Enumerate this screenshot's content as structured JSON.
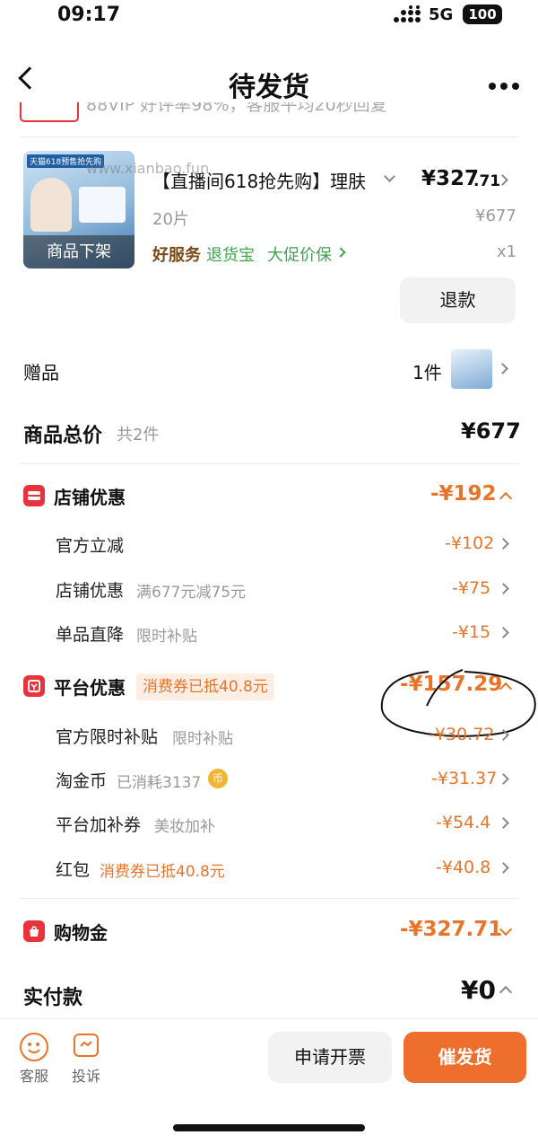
{
  "status_bar": {
    "time": "09:17",
    "network": "5G",
    "battery": "100"
  },
  "header": {
    "title": "待发货"
  },
  "top_strip": {
    "text": "88VIP 好评率98%，客服平均20秒回复"
  },
  "product": {
    "title": "【直播间618抢先购】理肤",
    "spec": "20片",
    "price": "¥327.71",
    "price_main": "¥327",
    "price_cents": ".71",
    "original_price": "¥677",
    "quantity": "x1",
    "image_overlay": "商品下架",
    "image_caption": "天猫618预售抢先购",
    "watermark": "www.xianbao.fun",
    "badge_good_service": "好服务",
    "badge_return": "退货宝",
    "badge_price_protect": "大促价保",
    "refund_button": "退款"
  },
  "gift": {
    "label": "赠品",
    "count": "1件"
  },
  "total": {
    "label": "商品总价",
    "count": "共2件",
    "value": "¥677"
  },
  "shop_discount": {
    "label": "店铺优惠",
    "value": "-¥192",
    "items": [
      {
        "label": "官方立减",
        "sub": "",
        "value": "-¥102"
      },
      {
        "label": "店铺优惠",
        "sub": "满677元减75元",
        "value": "-¥75"
      },
      {
        "label": "单品直降",
        "sub": "限时补贴",
        "value": "-¥15"
      }
    ]
  },
  "platform_discount": {
    "label": "平台优惠",
    "tag": "消费券已抵40.8元",
    "value": "-¥157.29",
    "items": [
      {
        "label": "官方限时补贴",
        "sub": "限时补贴",
        "value": "-¥30.72"
      },
      {
        "label": "淘金币",
        "sub": "已消耗3137",
        "coin": "币",
        "value": "-¥31.37"
      },
      {
        "label": "平台加补券",
        "sub": "美妆加补",
        "value": "-¥54.4"
      },
      {
        "label": "红包",
        "sub": "消费券已抵40.8元",
        "value": "-¥40.8"
      }
    ]
  },
  "shopping_gold": {
    "label": "购物金",
    "value": "-¥327.71"
  },
  "paid": {
    "label": "实付款",
    "value": "¥0"
  },
  "bottom_bar": {
    "service": "客服",
    "complaint": "投诉",
    "invoice_button": "申请开票",
    "urge_button": "催发货"
  },
  "colors": {
    "accent": "#e8742a",
    "red_icon": "#e8323c",
    "urge_button": "#ee6f2d",
    "green": "#3aa64a"
  }
}
